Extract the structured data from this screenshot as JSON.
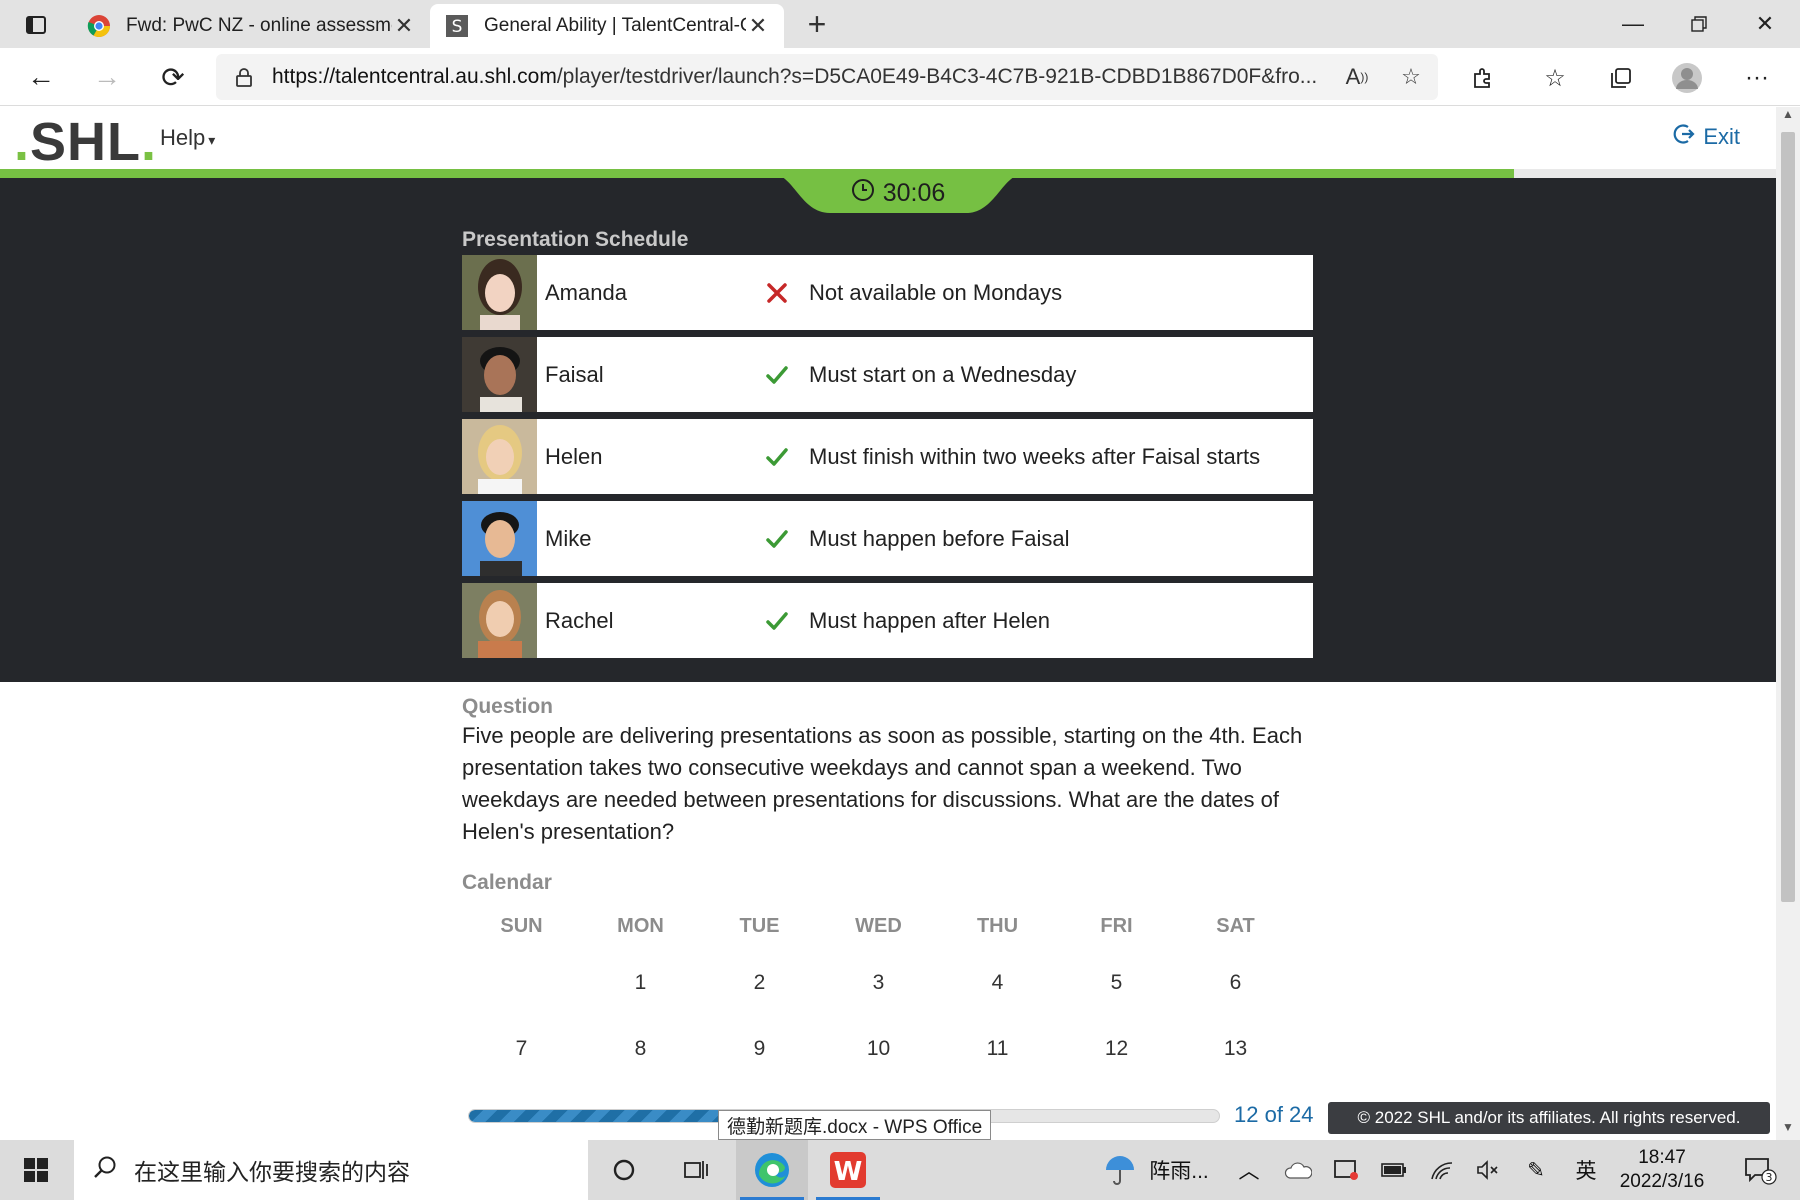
{
  "browser": {
    "tabs": [
      {
        "title": "Fwd: PwC NZ - online assessment",
        "active": false
      },
      {
        "title": "General Ability | TalentCentral-Candidate",
        "active": true
      }
    ],
    "url_host": "https://talentcentral.au.shl.com",
    "url_path": "/player/testdriver/launch?s=D5CA0E49-B4C3-4C7B-921B-CDBD1B867D0F&fro..."
  },
  "header": {
    "logo_text": "SHL",
    "logo_dot": ".",
    "logo_end_dot": ".",
    "help_label": "Help",
    "exit_label": "Exit"
  },
  "timer": {
    "value": "30:06"
  },
  "schedule": {
    "title": "Presentation Schedule",
    "rows": [
      {
        "name": "Amanda",
        "status": "cross",
        "rule": "Not available on Mondays"
      },
      {
        "name": "Faisal",
        "status": "check",
        "rule": "Must start on a Wednesday"
      },
      {
        "name": "Helen",
        "status": "check",
        "rule": "Must finish within two weeks after Faisal starts"
      },
      {
        "name": "Mike",
        "status": "check",
        "rule": "Must happen before Faisal"
      },
      {
        "name": "Rachel",
        "status": "check",
        "rule": "Must happen after Helen"
      }
    ]
  },
  "question": {
    "label": "Question",
    "text": "Five people are delivering presentations as soon as possible, starting on the 4th. Each presentation takes two consecutive weekdays and cannot span a weekend. Two weekdays are needed between presentations for discussions. What are the dates of Helen's presentation?"
  },
  "calendar": {
    "label": "Calendar",
    "headers": [
      "SUN",
      "MON",
      "TUE",
      "WED",
      "THU",
      "FRI",
      "SAT"
    ],
    "weeks": [
      [
        "",
        "1",
        "2",
        "3",
        "4",
        "5",
        "6"
      ],
      [
        "7",
        "8",
        "9",
        "10",
        "11",
        "12",
        "13"
      ]
    ]
  },
  "footer": {
    "progress_fraction": 0.5,
    "progress_text": "12 of 24",
    "copyright": "© 2022 SHL and/or its affiliates. All rights reserved.",
    "tooltip": "德勤新题库.docx - WPS Office"
  },
  "taskbar": {
    "search_placeholder": "在这里输入你要搜索的内容",
    "weather": "阵雨...",
    "ime": "英",
    "time": "18:47",
    "date": "2022/3/16",
    "notification_count": "3"
  },
  "colors": {
    "brand_green": "#76c043",
    "dark_panel": "#25272b",
    "link_blue": "#1b6aa5",
    "check_green": "#3c9a35",
    "cross_red": "#c62828"
  }
}
